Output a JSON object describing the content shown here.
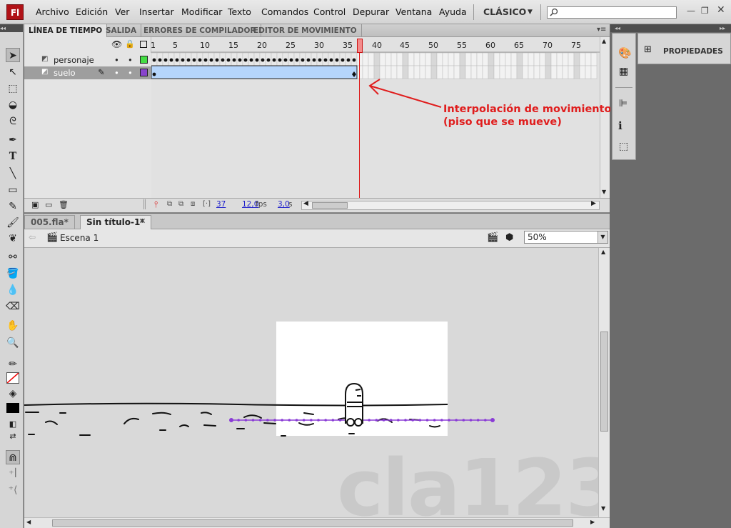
{
  "app": {
    "logo": "Fl",
    "workspace": "CLÁSICO"
  },
  "menu": [
    "Archivo",
    "Edición",
    "Ver",
    "Insertar",
    "Modificar",
    "Texto",
    "Comandos",
    "Control",
    "Depurar",
    "Ventana",
    "Ayuda"
  ],
  "timeline": {
    "tabs": [
      "LÍNEA DE TIEMPO",
      "SALIDA",
      "ERRORES DE COMPILADOR",
      "EDITOR DE MOVIMIENTO"
    ],
    "layers": [
      {
        "name": "personaje",
        "color": "#44dd44"
      },
      {
        "name": "suelo",
        "color": "#8844cc"
      }
    ],
    "frame_numbers": [
      "1",
      "5",
      "10",
      "15",
      "20",
      "25",
      "30",
      "35",
      "40",
      "45",
      "50",
      "55",
      "60",
      "65",
      "70",
      "75"
    ],
    "current_frame": "37",
    "fps": "12,0",
    "fps_unit": "fps",
    "time": "3,0",
    "time_unit": "s"
  },
  "annotation": {
    "line1": "Interpolación de movimiento",
    "line2": "(piso que se mueve)"
  },
  "documents": {
    "tabs": [
      "005.fla*",
      "Sin título-1*"
    ],
    "scene": "Escena 1",
    "zoom": "50%"
  },
  "watermark": "cla123",
  "panels": {
    "properties": "PROPIEDADES"
  }
}
